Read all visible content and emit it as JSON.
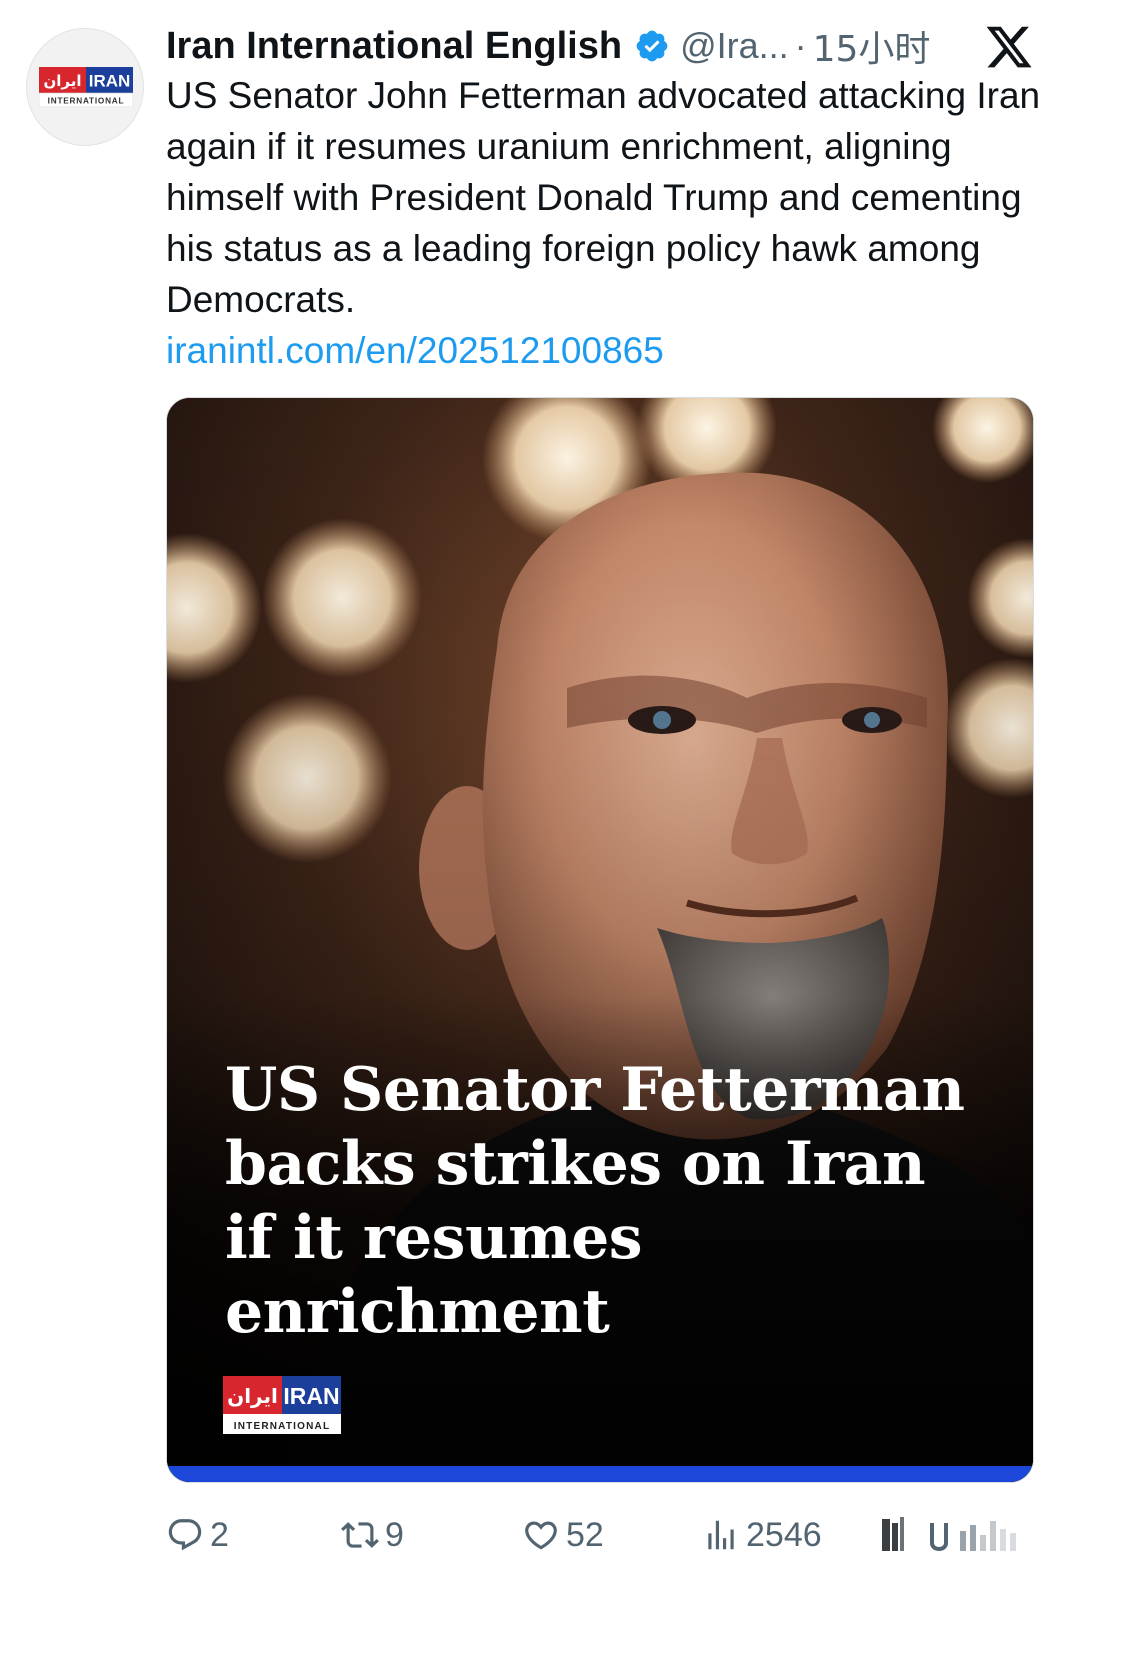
{
  "tweet": {
    "author": {
      "display_name": "Iran International English",
      "handle": "@Ira...",
      "verified": true,
      "avatar_logo": {
        "text_red": "ایران",
        "text_blue": "IRAN",
        "subtitle": "INTERNATIONAL"
      }
    },
    "separator": "·",
    "time": "15小时",
    "text": "US Senator John Fetterman advocated attacking Iran again if it resumes uranium enrichment, aligning himself with President Donald Trump and cementing his status as a leading foreign policy hawk among Democrats.",
    "link": "iranintl.com/en/202512100865",
    "media": {
      "headline": "US Senator Fetterman backs strikes on Iran if it resumes enrichment",
      "logo": {
        "text_red": "ایران",
        "text_blue": "IRAN",
        "subtitle": "INTERNATIONAL"
      },
      "accent_color": "#1c47d8"
    },
    "actions": {
      "replies": "2",
      "retweets": "9",
      "likes": "52",
      "views": "2546"
    }
  },
  "colors": {
    "text": "#0f1419",
    "muted": "#536471",
    "link": "#1d9bf0",
    "verified": "#1d9bf0",
    "logo_red": "#d7262e",
    "logo_blue": "#1b3f9b"
  },
  "icons": {
    "platform": "x-logo-icon",
    "verified": "verified-badge-icon",
    "reply": "reply-icon",
    "retweet": "retweet-icon",
    "like": "heart-icon",
    "views": "views-icon"
  }
}
